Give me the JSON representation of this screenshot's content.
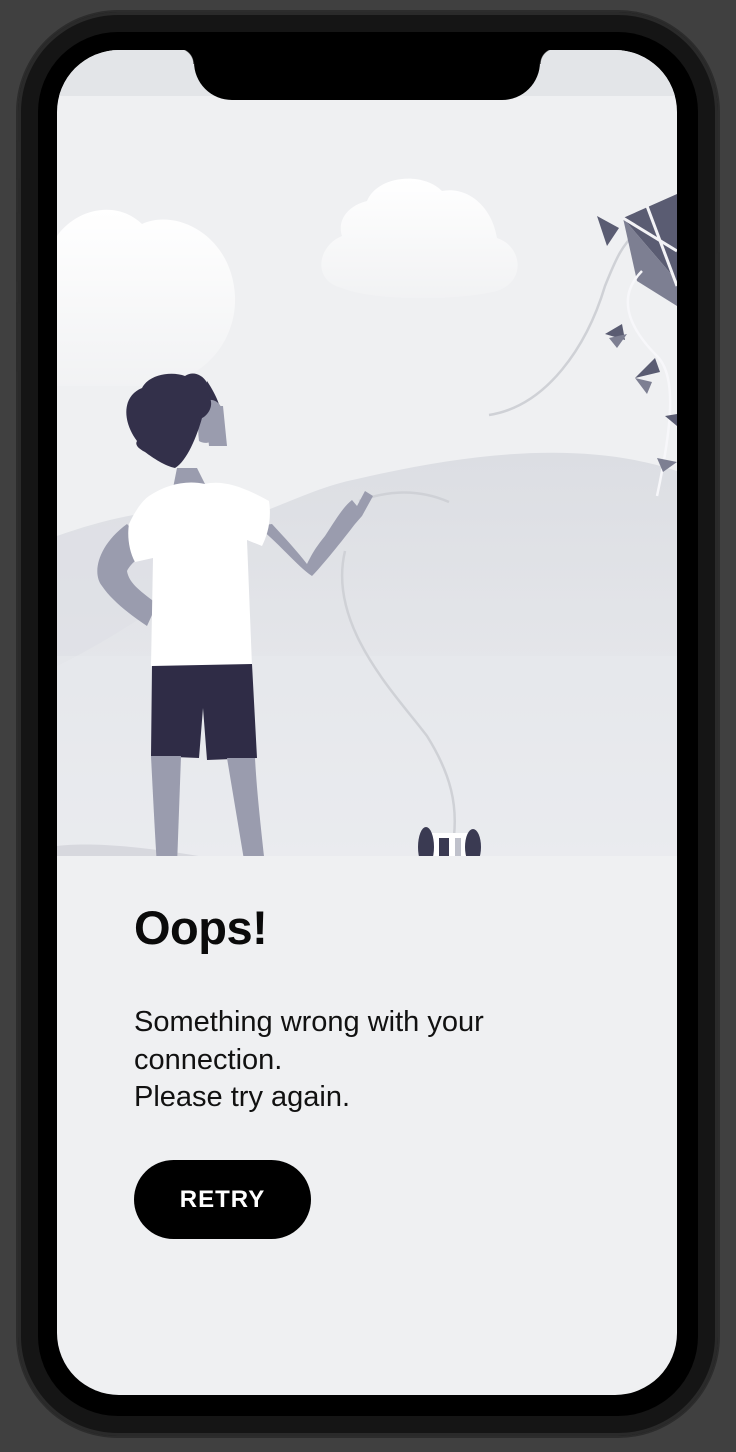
{
  "error_screen": {
    "title": "Oops!",
    "message_lines": [
      "Something wrong with your",
      "connection.",
      "Please try again."
    ],
    "retry_label": "RETRY"
  },
  "colors": {
    "background": "#eff0f2",
    "button": "#000000",
    "button_text": "#ffffff",
    "illustration_dark": "#33304a",
    "illustration_mid": "#9a9cae"
  },
  "icons": [
    "boy-flying-kite-illustration",
    "kite-icon",
    "string-spool-icon",
    "cloud-icon"
  ]
}
